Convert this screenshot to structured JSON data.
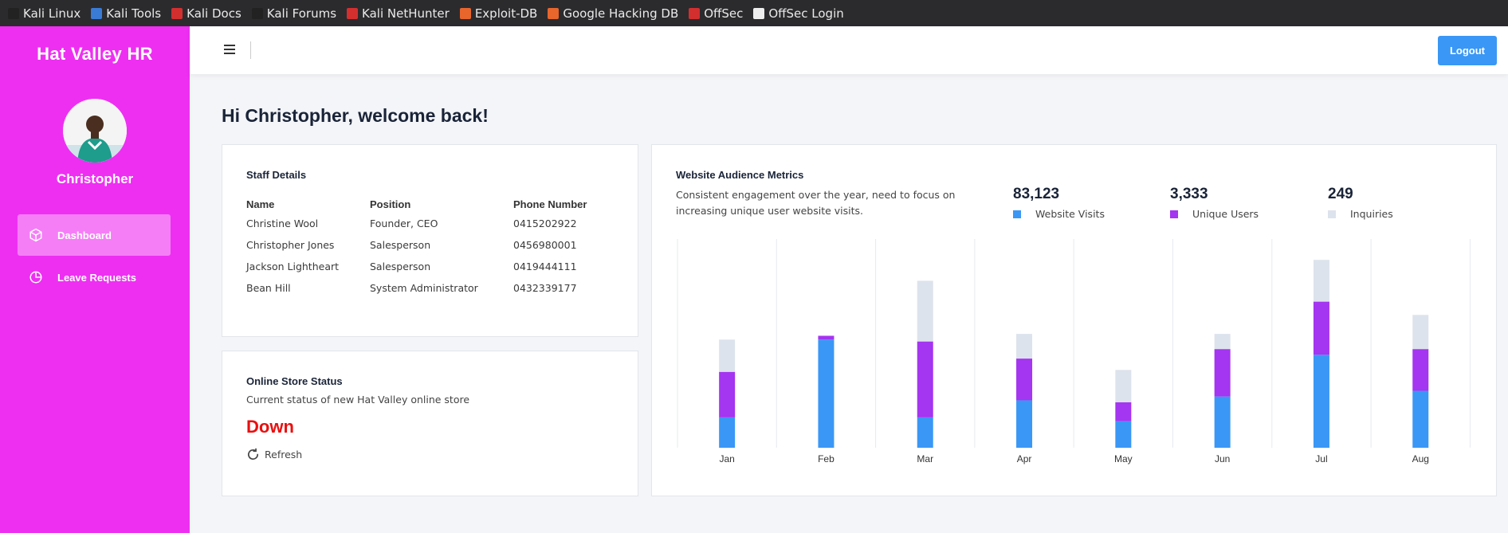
{
  "bookmarks": [
    {
      "label": "Kali Linux",
      "icon": "kali-dragon-icon",
      "color": "#222"
    },
    {
      "label": "Kali Tools",
      "icon": "kali-tools-icon",
      "color": "#3a7bd5"
    },
    {
      "label": "Kali Docs",
      "icon": "kali-docs-icon",
      "color": "#d32f2f"
    },
    {
      "label": "Kali Forums",
      "icon": "kali-forums-icon",
      "color": "#222"
    },
    {
      "label": "Kali NetHunter",
      "icon": "nethunter-icon",
      "color": "#d32f2f"
    },
    {
      "label": "Exploit-DB",
      "icon": "exploit-db-icon",
      "color": "#e8652c"
    },
    {
      "label": "Google Hacking DB",
      "icon": "ghdb-icon",
      "color": "#e8652c"
    },
    {
      "label": "OffSec",
      "icon": "offsec-icon",
      "color": "#d32f2f"
    },
    {
      "label": "OffSec Login",
      "icon": "offsec-login-icon",
      "color": "#eee"
    }
  ],
  "sidebar": {
    "brand": "Hat Valley HR",
    "user_name": "Christopher",
    "items": [
      {
        "label": "Dashboard",
        "icon": "cube-icon",
        "active": true
      },
      {
        "label": "Leave Requests",
        "icon": "pie-chart-icon",
        "active": false
      }
    ]
  },
  "topbar": {
    "logout_label": "Logout"
  },
  "welcome": "Hi Christopher, welcome back!",
  "staff": {
    "title": "Staff Details",
    "columns": [
      "Name",
      "Position",
      "Phone Number"
    ],
    "rows": [
      [
        "Christine Wool",
        "Founder, CEO",
        "0415202922"
      ],
      [
        "Christopher Jones",
        "Salesperson",
        "0456980001"
      ],
      [
        "Jackson Lightheart",
        "Salesperson",
        "0419444111"
      ],
      [
        "Bean Hill",
        "System Administrator",
        "0432339177"
      ]
    ]
  },
  "store": {
    "title": "Online Store Status",
    "description": "Current status of new Hat Valley online store",
    "status": "Down",
    "refresh_label": "Refresh"
  },
  "metrics": {
    "title": "Website Audience Metrics",
    "description": "Consistent engagement over the year, need to focus on increasing unique user website visits.",
    "stats": [
      {
        "value": "83,123",
        "label": "Website Visits",
        "color": "#3a97f5"
      },
      {
        "value": "3,333",
        "label": "Unique Users",
        "color": "#a435f0"
      },
      {
        "value": "249",
        "label": "Inquiries",
        "color": "#dde3ec"
      }
    ]
  },
  "chart_data": {
    "type": "bar",
    "stacked": true,
    "categories": [
      "Jan",
      "Feb",
      "Mar",
      "Apr",
      "May",
      "Jun",
      "Jul",
      "Aug"
    ],
    "series": [
      {
        "name": "Website Visits",
        "color": "#3a97f5",
        "values": [
          16,
          57,
          16,
          25,
          14,
          27,
          49,
          30
        ]
      },
      {
        "name": "Unique Users",
        "color": "#a435f0",
        "values": [
          24,
          2,
          40,
          22,
          10,
          25,
          28,
          22
        ]
      },
      {
        "name": "Inquiries",
        "color": "#dde3ec",
        "values": [
          17,
          0,
          32,
          13,
          17,
          8,
          22,
          18
        ]
      }
    ],
    "ylim": [
      0,
      110
    ],
    "grid": "vertical"
  }
}
